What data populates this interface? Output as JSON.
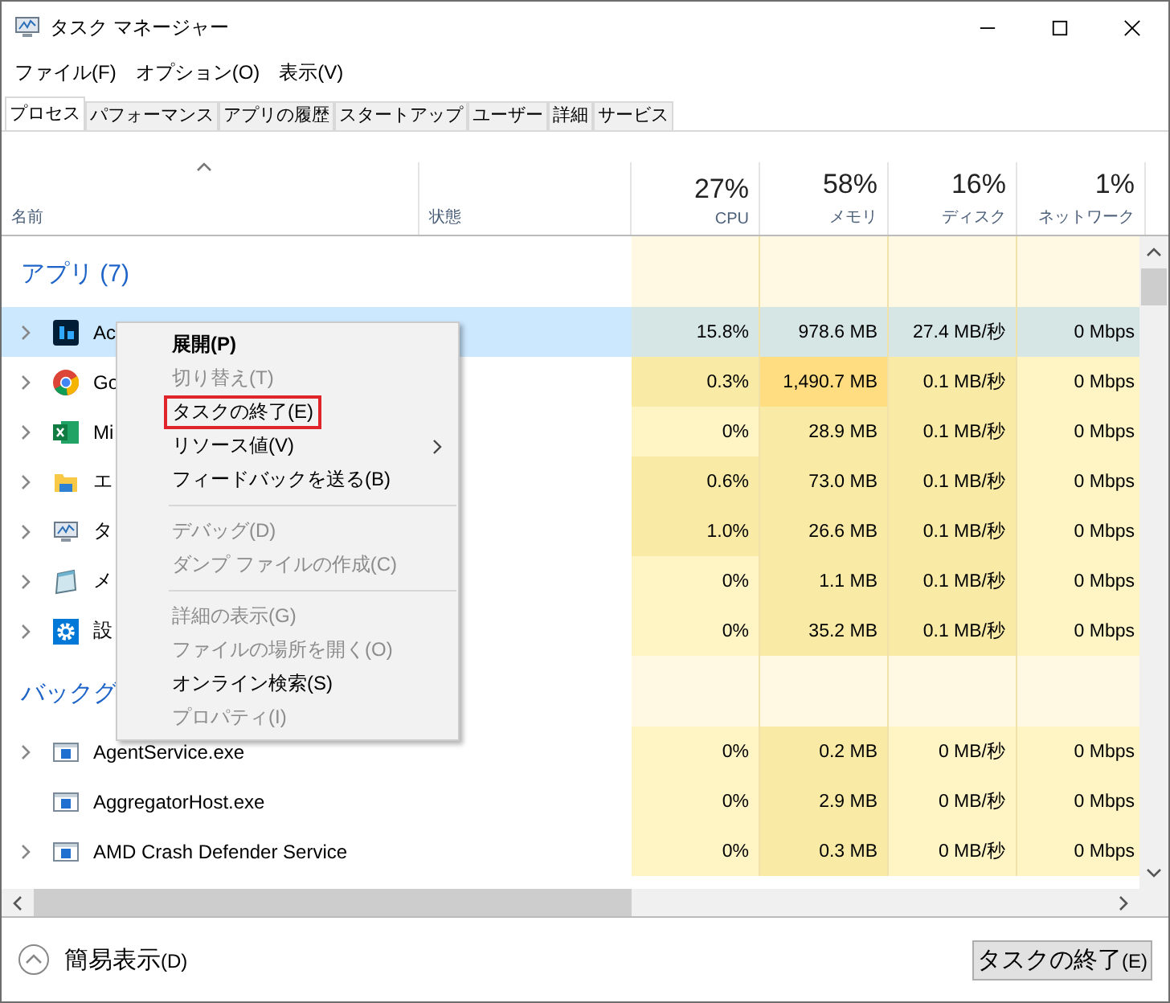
{
  "window": {
    "title": "タスク マネージャー"
  },
  "menu_bar": [
    "ファイル(F)",
    "オプション(O)",
    "表示(V)"
  ],
  "tabs": [
    {
      "label": "プロセス",
      "selected": true
    },
    {
      "label": "パフォーマンス",
      "selected": false
    },
    {
      "label": "アプリの履歴",
      "selected": false
    },
    {
      "label": "スタートアップ",
      "selected": false
    },
    {
      "label": "ユーザー",
      "selected": false
    },
    {
      "label": "詳細",
      "selected": false
    },
    {
      "label": "サービス",
      "selected": false
    }
  ],
  "columns": [
    {
      "label": "名前"
    },
    {
      "label": "状態"
    },
    {
      "total": "27%",
      "label": "CPU"
    },
    {
      "total": "58%",
      "label": "メモリ"
    },
    {
      "total": "16%",
      "label": "ディスク"
    },
    {
      "total": "1%",
      "label": "ネットワーク"
    }
  ],
  "groups": [
    {
      "title": "アプリ (7)",
      "rows": [
        {
          "name": "Ac",
          "expandable": true,
          "selected": true,
          "cells": [
            {
              "text": "15.8%",
              "color": "#d5e6e4"
            },
            {
              "text": "978.6 MB",
              "color": "#d5e6e4"
            },
            {
              "text": "27.4 MB/秒",
              "color": "#d5e6e4"
            },
            {
              "text": "0 Mbps",
              "color": "#d5e6e4"
            }
          ]
        },
        {
          "name": "Go",
          "expandable": true,
          "selected": false,
          "cells": [
            {
              "text": "0.3%",
              "color": "#f9eba6"
            },
            {
              "text": "1,490.7 MB",
              "color": "#ffdd80"
            },
            {
              "text": "0.1 MB/秒",
              "color": "#f9eba6"
            },
            {
              "text": "0 Mbps",
              "color": "#fff4c4"
            }
          ]
        },
        {
          "name": "Mi",
          "expandable": true,
          "selected": false,
          "cells": [
            {
              "text": "0%",
              "color": "#fff4c4"
            },
            {
              "text": "28.9 MB",
              "color": "#f9eba6"
            },
            {
              "text": "0.1 MB/秒",
              "color": "#f9eba6"
            },
            {
              "text": "0 Mbps",
              "color": "#fff4c4"
            }
          ]
        },
        {
          "name": "エ",
          "expandable": true,
          "selected": false,
          "cells": [
            {
              "text": "0.6%",
              "color": "#f9eba6"
            },
            {
              "text": "73.0 MB",
              "color": "#f9eba6"
            },
            {
              "text": "0.1 MB/秒",
              "color": "#f9eba6"
            },
            {
              "text": "0 Mbps",
              "color": "#fff4c4"
            }
          ]
        },
        {
          "name": "タ",
          "expandable": true,
          "selected": false,
          "cells": [
            {
              "text": "1.0%",
              "color": "#f9eba6"
            },
            {
              "text": "26.6 MB",
              "color": "#f9eba6"
            },
            {
              "text": "0.1 MB/秒",
              "color": "#f9eba6"
            },
            {
              "text": "0 Mbps",
              "color": "#fff4c4"
            }
          ]
        },
        {
          "name": "メ",
          "expandable": true,
          "selected": false,
          "cells": [
            {
              "text": "0%",
              "color": "#fff4c4"
            },
            {
              "text": "1.1 MB",
              "color": "#f9eba6"
            },
            {
              "text": "0.1 MB/秒",
              "color": "#f9eba6"
            },
            {
              "text": "0 Mbps",
              "color": "#fff4c4"
            }
          ]
        },
        {
          "name": "設",
          "expandable": true,
          "selected": false,
          "cells": [
            {
              "text": "0%",
              "color": "#fff4c4"
            },
            {
              "text": "35.2 MB",
              "color": "#f9eba6"
            },
            {
              "text": "0.1 MB/秒",
              "color": "#f9eba6"
            },
            {
              "text": "0 Mbps",
              "color": "#fff4c4"
            }
          ]
        }
      ]
    },
    {
      "title": "バックグ",
      "rows": [
        {
          "name": "AgentService.exe",
          "expandable": true,
          "selected": false,
          "cells": [
            {
              "text": "0%",
              "color": "#fff4c4"
            },
            {
              "text": "0.2 MB",
              "color": "#f9eba6"
            },
            {
              "text": "0 MB/秒",
              "color": "#fff4c4"
            },
            {
              "text": "0 Mbps",
              "color": "#fff4c4"
            }
          ]
        },
        {
          "name": "AggregatorHost.exe",
          "expandable": false,
          "selected": false,
          "cells": [
            {
              "text": "0%",
              "color": "#fff4c4"
            },
            {
              "text": "2.9 MB",
              "color": "#f9eba6"
            },
            {
              "text": "0 MB/秒",
              "color": "#fff4c4"
            },
            {
              "text": "0 Mbps",
              "color": "#fff4c4"
            }
          ]
        },
        {
          "name": "AMD Crash Defender Service",
          "expandable": true,
          "selected": false,
          "cells": [
            {
              "text": "0%",
              "color": "#fff4c4"
            },
            {
              "text": "0.3 MB",
              "color": "#f9eba6"
            },
            {
              "text": "0 MB/秒",
              "color": "#fff4c4"
            },
            {
              "text": "0 Mbps",
              "color": "#fff4c4"
            }
          ]
        }
      ]
    }
  ],
  "context_menu": [
    {
      "kind": "item",
      "label": "展開(P)",
      "bold": true,
      "disabled": false,
      "outlined": false,
      "submenu": false
    },
    {
      "kind": "item",
      "label": "切り替え(T)",
      "bold": false,
      "disabled": true,
      "outlined": false,
      "submenu": false
    },
    {
      "kind": "item",
      "label": "タスクの終了(E)",
      "bold": false,
      "disabled": false,
      "outlined": true,
      "submenu": false
    },
    {
      "kind": "item",
      "label": "リソース値(V)",
      "bold": false,
      "disabled": false,
      "outlined": false,
      "submenu": true
    },
    {
      "kind": "item",
      "label": "フィードバックを送る(B)",
      "bold": false,
      "disabled": false,
      "outlined": false,
      "submenu": false
    },
    {
      "kind": "separator"
    },
    {
      "kind": "item",
      "label": "デバッグ(D)",
      "bold": false,
      "disabled": true,
      "outlined": false,
      "submenu": false
    },
    {
      "kind": "item",
      "label": "ダンプ ファイルの作成(C)",
      "bold": false,
      "disabled": true,
      "outlined": false,
      "submenu": false
    },
    {
      "kind": "separator"
    },
    {
      "kind": "item",
      "label": "詳細の表示(G)",
      "bold": false,
      "disabled": true,
      "outlined": false,
      "submenu": false
    },
    {
      "kind": "item",
      "label": "ファイルの場所を開く(O)",
      "bold": false,
      "disabled": true,
      "outlined": false,
      "submenu": false
    },
    {
      "kind": "item",
      "label": "オンライン検索(S)",
      "bold": false,
      "disabled": false,
      "outlined": false,
      "submenu": false
    },
    {
      "kind": "item",
      "label": "プロパティ(I)",
      "bold": false,
      "disabled": true,
      "outlined": false,
      "submenu": false
    }
  ],
  "footer": {
    "toggle": {
      "label": "簡易表示",
      "accelerator": "(D)"
    },
    "button": {
      "label": "タスクの終了",
      "accelerator": "(E)"
    }
  }
}
